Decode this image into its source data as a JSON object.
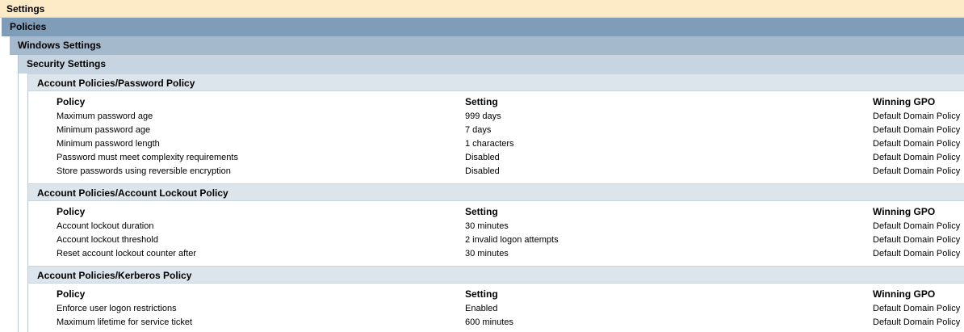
{
  "tree": {
    "settings": "Settings",
    "policies": "Policies",
    "windows_settings": "Windows Settings",
    "security_settings": "Security Settings"
  },
  "sections": [
    {
      "title": "Account Policies/Password Policy",
      "headers": [
        "Policy",
        "Setting",
        "Winning GPO"
      ],
      "rows": [
        [
          "Maximum password age",
          "999 days",
          "Default Domain Policy"
        ],
        [
          "Minimum password age",
          "7 days",
          "Default Domain Policy"
        ],
        [
          "Minimum password length",
          "1 characters",
          "Default Domain Policy"
        ],
        [
          "Password must meet complexity requirements",
          "Disabled",
          "Default Domain Policy"
        ],
        [
          "Store passwords using reversible encryption",
          "Disabled",
          "Default Domain Policy"
        ]
      ]
    },
    {
      "title": "Account Policies/Account Lockout Policy",
      "headers": [
        "Policy",
        "Setting",
        "Winning GPO"
      ],
      "rows": [
        [
          "Account lockout duration",
          "30 minutes",
          "Default Domain Policy"
        ],
        [
          "Account lockout threshold",
          "2 invalid logon attempts",
          "Default Domain Policy"
        ],
        [
          "Reset account lockout counter after",
          "30 minutes",
          "Default Domain Policy"
        ]
      ]
    },
    {
      "title": "Account Policies/Kerberos Policy",
      "headers": [
        "Policy",
        "Setting",
        "Winning GPO"
      ],
      "rows": [
        [
          "Enforce user logon restrictions",
          "Enabled",
          "Default Domain Policy"
        ],
        [
          "Maximum lifetime for service ticket",
          "600 minutes",
          "Default Domain Policy"
        ]
      ]
    }
  ]
}
